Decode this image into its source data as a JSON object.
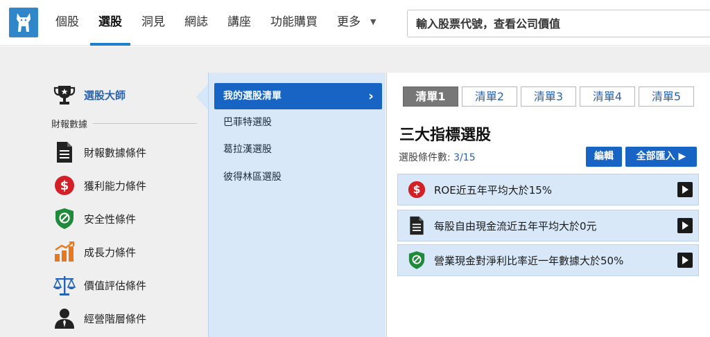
{
  "nav": {
    "items": [
      {
        "label": "個股"
      },
      {
        "label": "選股",
        "active": true
      },
      {
        "label": "洞見"
      },
      {
        "label": "網誌"
      },
      {
        "label": "講座"
      },
      {
        "label": "功能購買"
      },
      {
        "label": "更多"
      }
    ],
    "search_placeholder": "輸入股票代號，查看公司價值"
  },
  "sidebar": {
    "master_label": "選股大師",
    "section_label": "財報數據",
    "items": [
      {
        "label": "財報數據條件",
        "icon": "document-icon"
      },
      {
        "label": "獲利能力條件",
        "icon": "dollar-icon"
      },
      {
        "label": "安全性條件",
        "icon": "shield-icon"
      },
      {
        "label": "成長力條件",
        "icon": "growth-chart-icon"
      },
      {
        "label": "價值評估條件",
        "icon": "scales-icon"
      },
      {
        "label": "經營階層條件",
        "icon": "manager-icon"
      }
    ]
  },
  "lists": {
    "items": [
      {
        "label": "我的選股清單",
        "active": true
      },
      {
        "label": "巴菲特選股"
      },
      {
        "label": "葛拉漢選股"
      },
      {
        "label": "彼得林區選股"
      }
    ]
  },
  "content": {
    "tabs": [
      {
        "label": "清單1",
        "active": true
      },
      {
        "label": "清單2"
      },
      {
        "label": "清單3"
      },
      {
        "label": "清單4"
      },
      {
        "label": "清單5"
      }
    ],
    "title": "三大指標選股",
    "count_label": "選股條件數:",
    "count_value": "3/15",
    "edit_label": "編輯",
    "import_label": "全部匯入 ▶",
    "criteria": [
      {
        "text": "ROE近五年平均大於15%",
        "icon": "dollar-icon"
      },
      {
        "text": "每股自由現金流近五年平均大於0元",
        "icon": "document-icon"
      },
      {
        "text": "營業現金對淨利比率近一年數據大於50%",
        "icon": "shield-icon"
      }
    ]
  },
  "colors": {
    "brand_blue": "#1864c4",
    "nav_accent": "#1d7fd0",
    "panel_blue": "#d8e8f8",
    "dollar_red": "#d32027",
    "shield_green": "#1f8a3a",
    "growth_orange": "#e8781e"
  }
}
